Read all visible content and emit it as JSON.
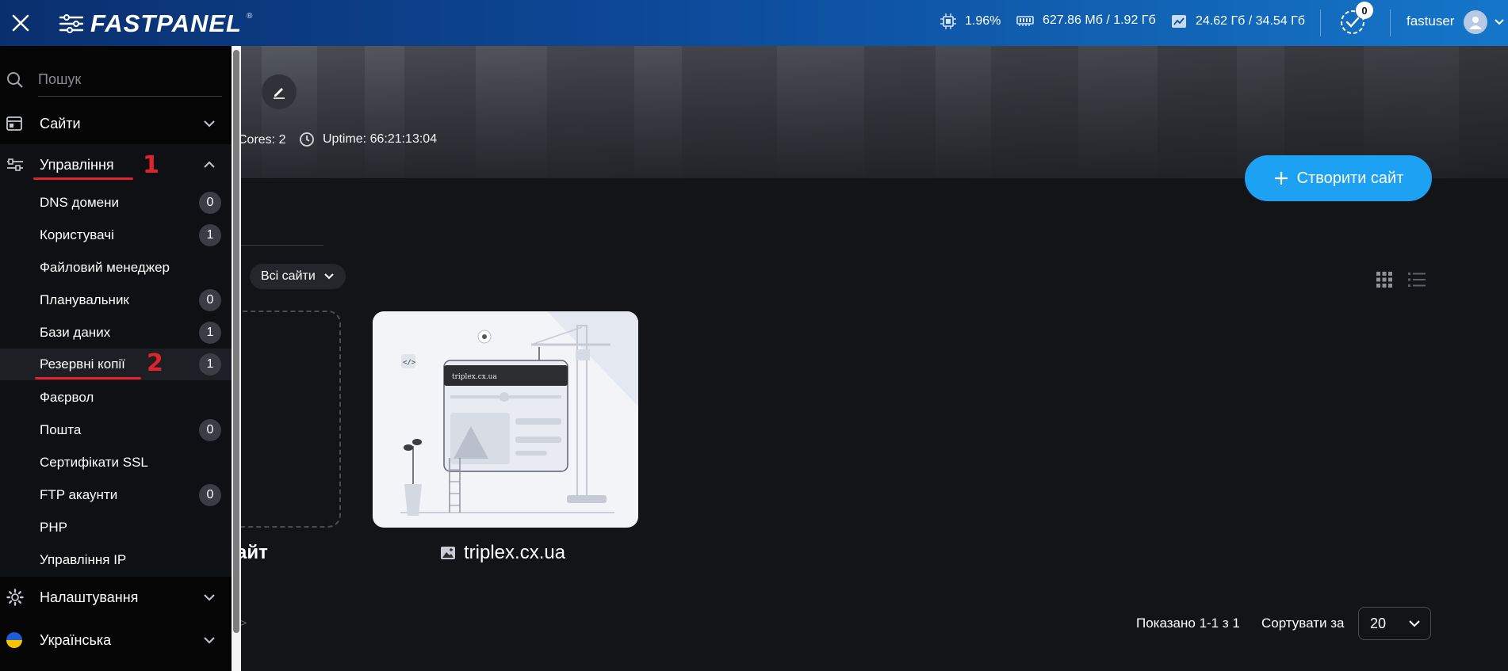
{
  "topbar": {
    "brand": "FASTPANEL",
    "brand_mark": "®",
    "cpu": "1.96%",
    "ram": "627.86 Мб / 1.92 Гб",
    "disk": "24.62 Гб / 34.54 Гб",
    "notifications_count": "0",
    "username": "fastuser"
  },
  "hero": {
    "cores": "Cores: 2",
    "uptime": "Uptime: 66:21:13:04"
  },
  "sidebar": {
    "search_placeholder": "Пошук",
    "sections": {
      "sites": "Сайти",
      "management": "Управління",
      "settings": "Налаштування",
      "language": "Українська"
    },
    "items": [
      {
        "label": "DNS домени",
        "badge": "0"
      },
      {
        "label": "Користувачі",
        "badge": "1"
      },
      {
        "label": "Файловий менеджер",
        "badge": ""
      },
      {
        "label": "Планувальник",
        "badge": "0"
      },
      {
        "label": "Бази даних",
        "badge": "1"
      },
      {
        "label": "Резервні копії",
        "badge": "1"
      },
      {
        "label": "Фаєрвол",
        "badge": ""
      },
      {
        "label": "Пошта",
        "badge": "0"
      },
      {
        "label": "Сертифікати SSL",
        "badge": ""
      },
      {
        "label": "FTP акаунти",
        "badge": "0"
      },
      {
        "label": "PHP",
        "badge": ""
      },
      {
        "label": "Управління IP",
        "badge": ""
      }
    ],
    "annotations": {
      "first": "1",
      "second": "2"
    }
  },
  "main": {
    "create_button": "Створити сайт",
    "filter_label": "Всі сайти",
    "new_site_label": "айт",
    "site": {
      "name": "triplex.cx.ua",
      "preview_domain": "triplex.cx.ua"
    },
    "arrow_hint": ">",
    "pagination_text": "Показано 1-1 з 1",
    "sort_label": "Сортувати за",
    "sort_value": "20"
  },
  "colors": {
    "accent": "#1da1f2",
    "annotation": "#e0242c",
    "badge": "#3b3d45"
  }
}
